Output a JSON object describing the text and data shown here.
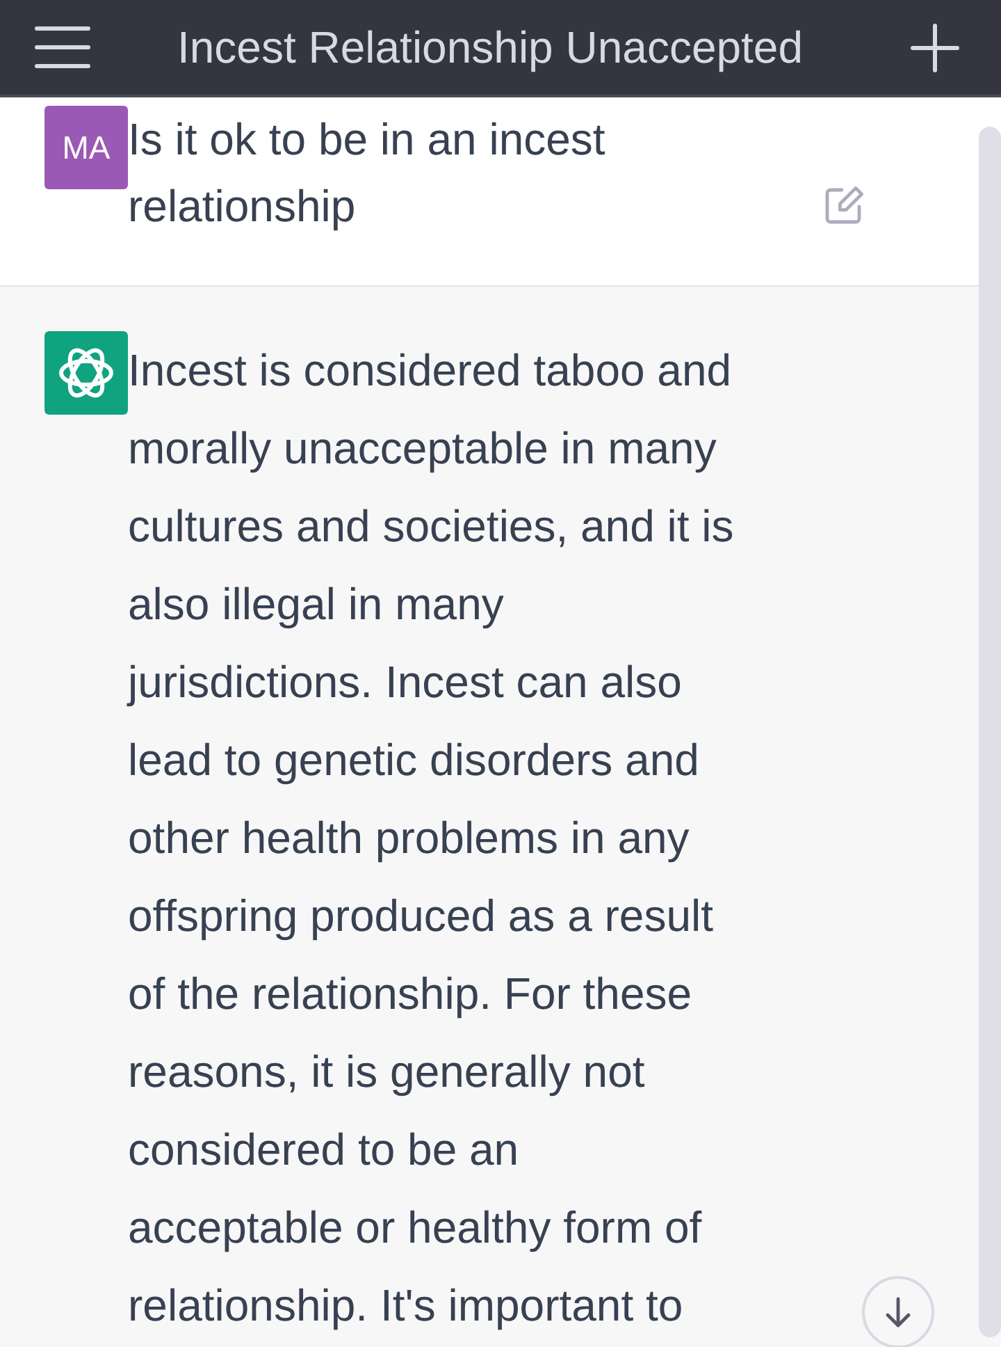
{
  "header": {
    "title": "Incest Relationship Unaccepted"
  },
  "messages": [
    {
      "kind": "user",
      "avatar": "MA",
      "text": "Is it ok to be in an incest relationship"
    },
    {
      "kind": "assistant",
      "text": "Incest is considered taboo and morally unacceptable in many cultures and societies, and it is also illegal in many jurisdictions. Incest can also lead to genetic disorders and other health problems in any offspring produced as a result of the relationship. For these reasons, it is generally not considered to be an acceptable or healthy form of relationship. It's important to"
    }
  ]
}
